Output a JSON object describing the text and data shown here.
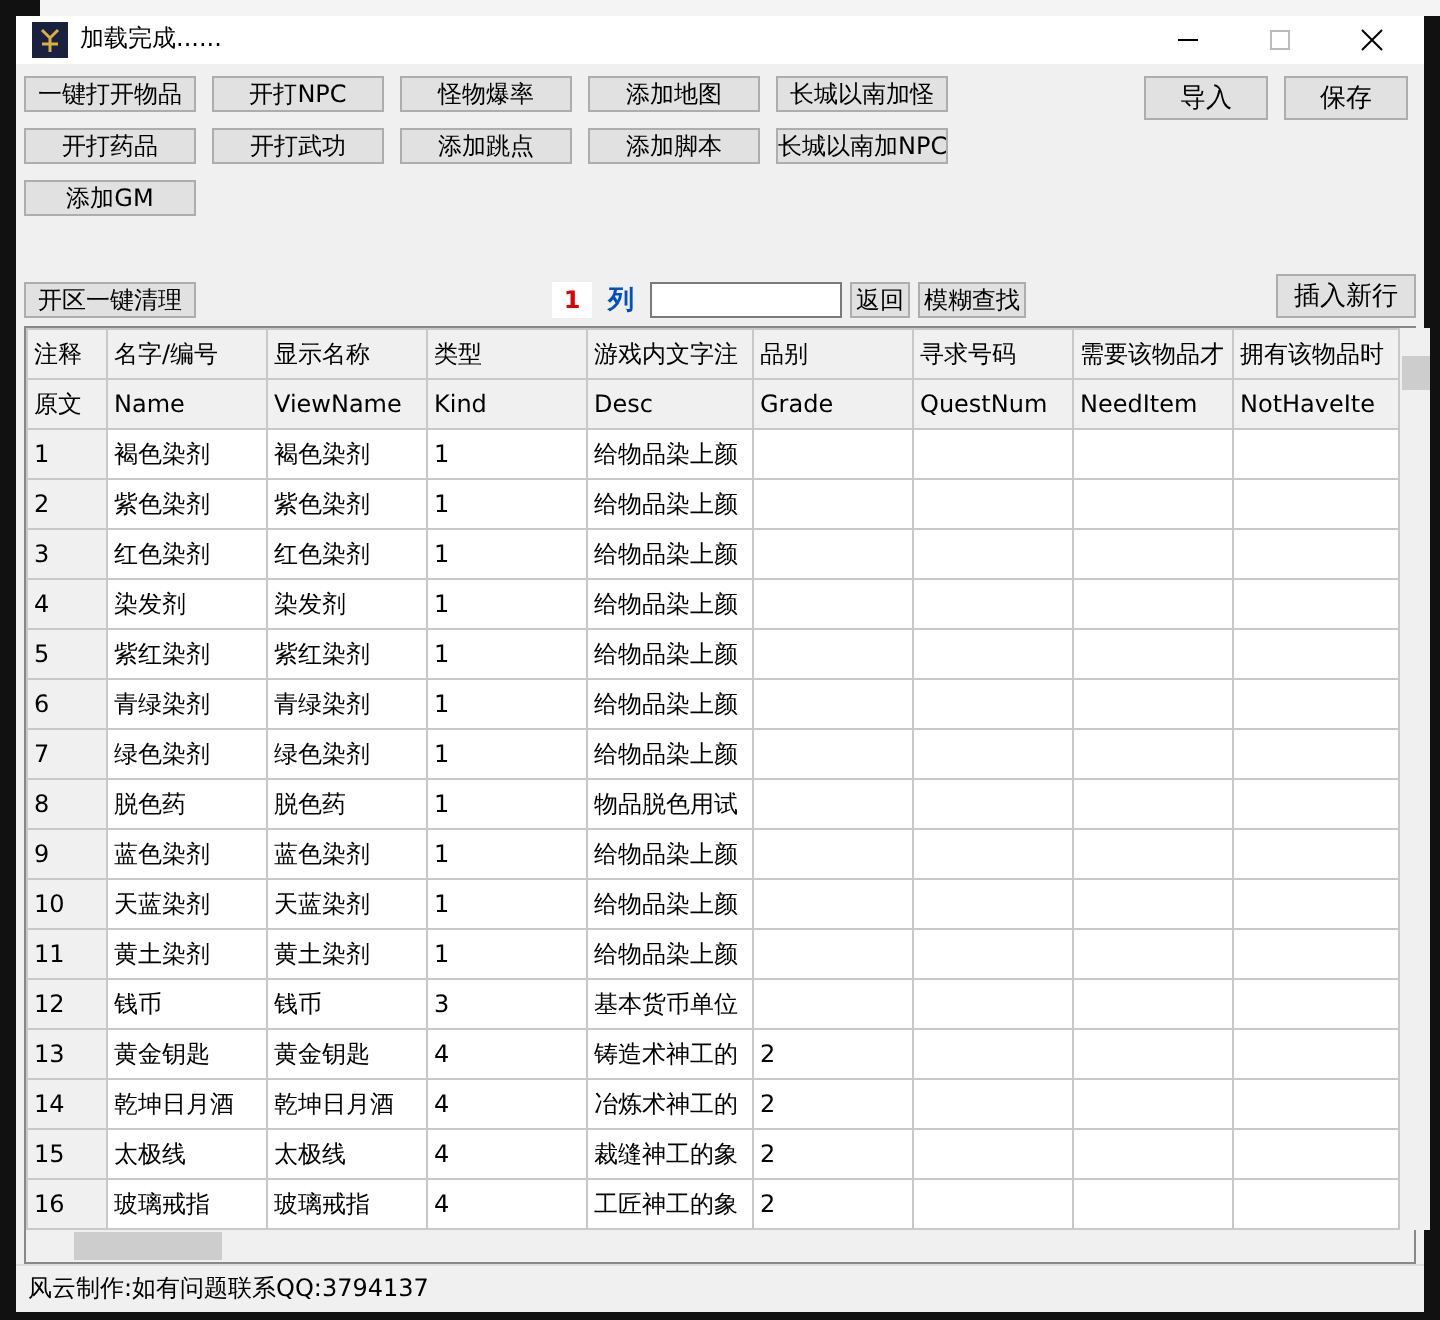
{
  "window": {
    "title": "加载完成......"
  },
  "toolbar": {
    "rows": [
      [
        "一键打开物品",
        "开打NPC",
        "怪物爆率",
        "添加地图",
        "长城以南加怪"
      ],
      [
        "开打药品",
        "开打武功",
        "添加跳点",
        "添加脚本",
        "长城以南加NPC"
      ],
      [
        "添加GM"
      ]
    ],
    "right_buttons": [
      "导入",
      "保存"
    ]
  },
  "search_bar": {
    "clear_button": "开区一键清理",
    "column_number": "1",
    "column_label": "列",
    "return_button": "返回",
    "fuzzy_button": "模糊查找",
    "insert_button": "插入新行"
  },
  "table": {
    "header_rows": [
      [
        "注释",
        "名字/编号",
        "显示名称",
        "类型",
        "游戏内文字注",
        "品别",
        "寻求号码",
        "需要该物品才",
        "拥有该物品时"
      ],
      [
        "原文",
        "Name",
        "ViewName",
        "Kind",
        "Desc",
        "Grade",
        "QuestNum",
        "NeedItem",
        "NotHaveIte"
      ]
    ],
    "rows": [
      [
        "1",
        "褐色染剂",
        "褐色染剂",
        "1",
        "给物品染上颜",
        "",
        "",
        "",
        ""
      ],
      [
        "2",
        "紫色染剂",
        "紫色染剂",
        "1",
        "给物品染上颜",
        "",
        "",
        "",
        ""
      ],
      [
        "3",
        "红色染剂",
        "红色染剂",
        "1",
        "给物品染上颜",
        "",
        "",
        "",
        ""
      ],
      [
        "4",
        "染发剂",
        "染发剂",
        "1",
        "给物品染上颜",
        "",
        "",
        "",
        ""
      ],
      [
        "5",
        "紫红染剂",
        "紫红染剂",
        "1",
        "给物品染上颜",
        "",
        "",
        "",
        ""
      ],
      [
        "6",
        "青绿染剂",
        "青绿染剂",
        "1",
        "给物品染上颜",
        "",
        "",
        "",
        ""
      ],
      [
        "7",
        "绿色染剂",
        "绿色染剂",
        "1",
        "给物品染上颜",
        "",
        "",
        "",
        ""
      ],
      [
        "8",
        "脱色药",
        "脱色药",
        "1",
        "物品脱色用试",
        "",
        "",
        "",
        ""
      ],
      [
        "9",
        "蓝色染剂",
        "蓝色染剂",
        "1",
        "给物品染上颜",
        "",
        "",
        "",
        ""
      ],
      [
        "10",
        "天蓝染剂",
        "天蓝染剂",
        "1",
        "给物品染上颜",
        "",
        "",
        "",
        ""
      ],
      [
        "11",
        "黄土染剂",
        "黄土染剂",
        "1",
        "给物品染上颜",
        "",
        "",
        "",
        ""
      ],
      [
        "12",
        "钱币",
        "钱币",
        "3",
        "基本货币单位",
        "",
        "",
        "",
        ""
      ],
      [
        "13",
        "黄金钥匙",
        "黄金钥匙",
        "4",
        "铸造术神工的",
        "2",
        "",
        "",
        ""
      ],
      [
        "14",
        "乾坤日月酒",
        "乾坤日月酒",
        "4",
        "冶炼术神工的",
        "2",
        "",
        "",
        ""
      ],
      [
        "15",
        "太极线",
        "太极线",
        "4",
        "裁缝神工的象",
        "2",
        "",
        "",
        ""
      ],
      [
        "16",
        "玻璃戒指",
        "玻璃戒指",
        "4",
        "工匠神工的象",
        "2",
        "",
        "",
        ""
      ]
    ]
  },
  "status_bar": "风云制作:如有问题联系QQ:3794137"
}
